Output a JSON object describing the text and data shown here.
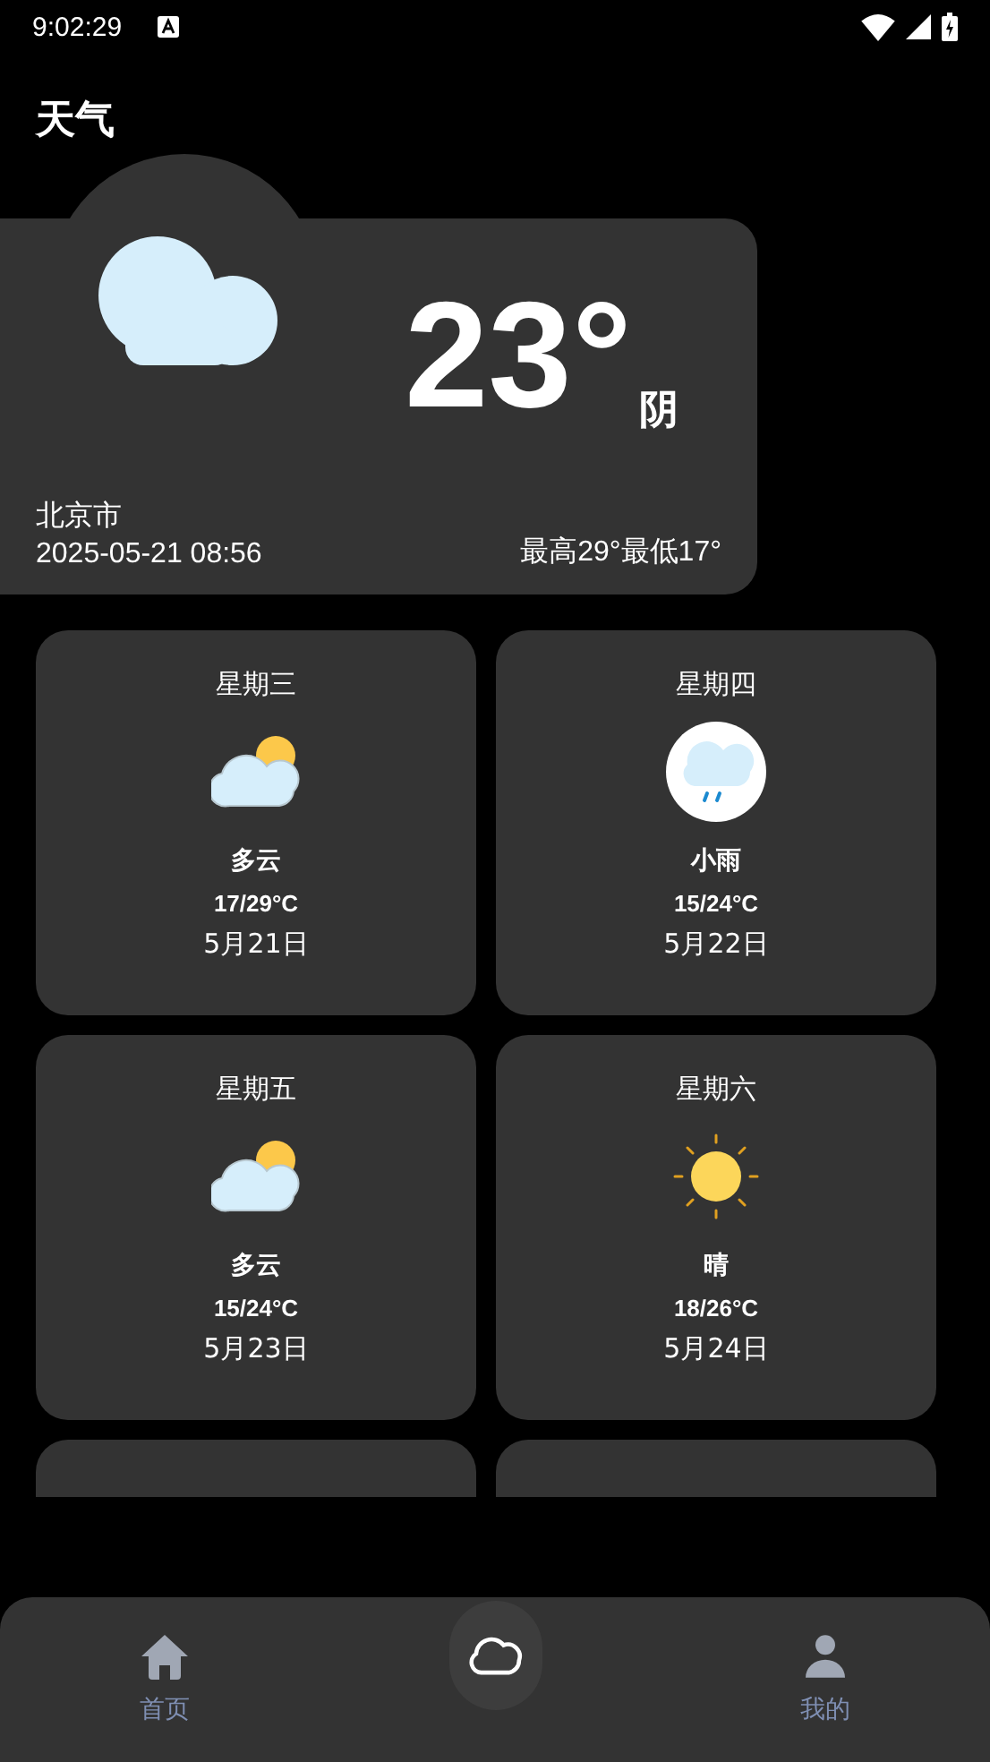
{
  "status_bar": {
    "time": "9:02:29"
  },
  "title": "天气",
  "current": {
    "kind": "overcast",
    "temperature": "23°",
    "condition": "阴",
    "city": "北京市",
    "updated": "2025-05-21 08:56",
    "range": "最高29°最低17°"
  },
  "forecast": [
    {
      "kind": "partly_cloudy",
      "weekday": "星期三",
      "condition": "多云",
      "temps": "17/29°C",
      "date": "5月21日"
    },
    {
      "kind": "light_rain",
      "weekday": "星期四",
      "condition": "小雨",
      "temps": "15/24°C",
      "date": "5月22日"
    },
    {
      "kind": "partly_cloudy",
      "weekday": "星期五",
      "condition": "多云",
      "temps": "15/24°C",
      "date": "5月23日"
    },
    {
      "kind": "sunny",
      "weekday": "星期六",
      "condition": "晴",
      "temps": "18/26°C",
      "date": "5月24日"
    },
    {
      "kind": "cut"
    },
    {
      "kind": "cut"
    }
  ],
  "nav": [
    {
      "kind": "home",
      "label": "首页",
      "selected": false
    },
    {
      "kind": "weather",
      "selected": true
    },
    {
      "kind": "profile",
      "label": "我的",
      "selected": false
    }
  ]
}
